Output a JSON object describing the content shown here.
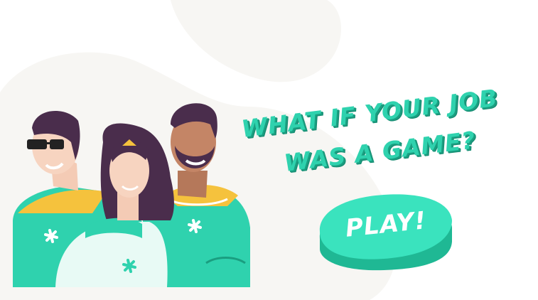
{
  "headline": {
    "line1": "WHAT IF YOUR JOB",
    "line2": "WAS A GAME?"
  },
  "play_button": {
    "label": "PLAY!"
  },
  "colors": {
    "accent": "#2fd2ae",
    "accent_dark": "#1a9e80",
    "background_blob": "#f7f6f3",
    "cape": "#f5c23d",
    "hair": "#4a2d4c"
  },
  "icons": {
    "hero_emblem": "asterisk-icon"
  }
}
